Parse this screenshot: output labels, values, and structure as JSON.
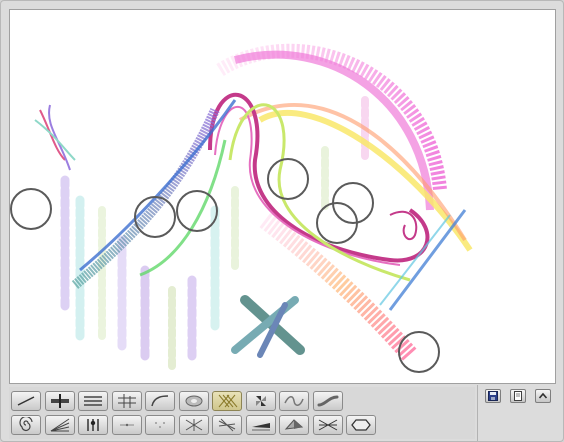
{
  "app": {
    "canvas_label": "drawing-canvas"
  },
  "toolbar": {
    "rows": [
      [
        {
          "name": "tool-line",
          "icon": "line-icon"
        },
        {
          "name": "tool-bar",
          "icon": "bar-icon"
        },
        {
          "name": "tool-parallel",
          "icon": "parallel-lines-icon"
        },
        {
          "name": "tool-grid",
          "icon": "grid-lines-icon"
        },
        {
          "name": "tool-curve",
          "icon": "curve-icon"
        },
        {
          "name": "tool-ellipse",
          "icon": "ellipse-icon"
        },
        {
          "name": "tool-diagonal-hatch",
          "icon": "diagonal-hatch-icon",
          "active": true
        },
        {
          "name": "tool-pinwheel",
          "icon": "pinwheel-icon"
        },
        {
          "name": "tool-wave",
          "icon": "wave-icon"
        },
        {
          "name": "tool-smooth-stroke",
          "icon": "smooth-stroke-icon"
        }
      ],
      [
        {
          "name": "tool-spiral",
          "icon": "spiral-icon"
        },
        {
          "name": "tool-fan",
          "icon": "fan-lines-icon"
        },
        {
          "name": "tool-sliders",
          "icon": "sliders-icon"
        },
        {
          "name": "tool-thin-lines",
          "icon": "thin-lines-icon"
        },
        {
          "name": "tool-dots",
          "icon": "dots-icon"
        },
        {
          "name": "tool-web",
          "icon": "web-icon"
        },
        {
          "name": "tool-scatter-strokes",
          "icon": "scatter-strokes-icon"
        },
        {
          "name": "tool-wedge",
          "icon": "wedge-icon"
        },
        {
          "name": "tool-shaded",
          "icon": "shaded-icon"
        },
        {
          "name": "tool-cross-weave",
          "icon": "cross-weave-icon"
        },
        {
          "name": "tool-hexagon",
          "icon": "hexagon-icon"
        }
      ]
    ]
  },
  "side_buttons": [
    {
      "name": "save-button",
      "icon": "save-icon"
    },
    {
      "name": "new-page-button",
      "icon": "new-page-icon"
    },
    {
      "name": "collapse-button",
      "icon": "chevron-up-icon"
    }
  ]
}
